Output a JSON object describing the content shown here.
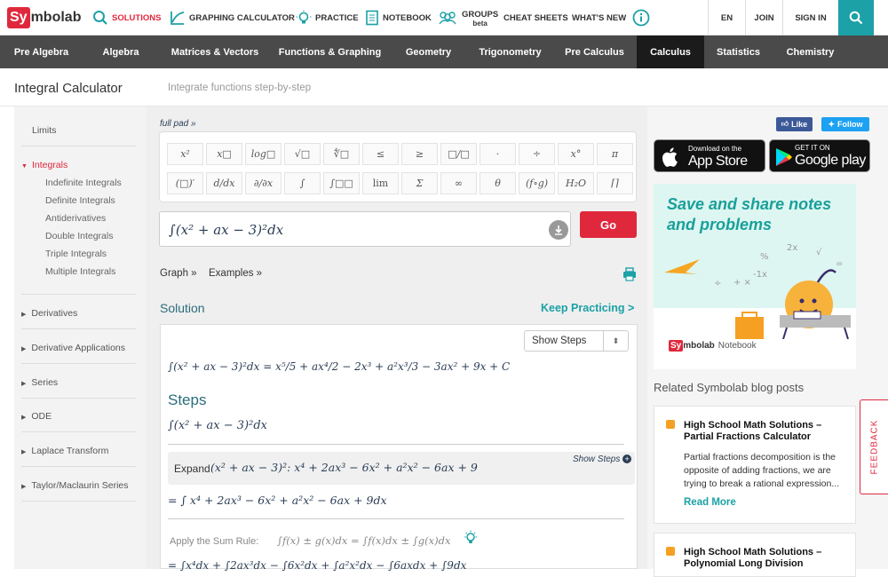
{
  "brand": {
    "sy": "Sy",
    "rest": "mbolab"
  },
  "topnav": [
    {
      "label": "SOLUTIONS",
      "icon": "search-icon"
    },
    {
      "label": "GRAPHING CALCULATOR",
      "icon": "graph-icon"
    },
    {
      "label": "PRACTICE",
      "icon": "bulb-icon"
    },
    {
      "label": "NOTEBOOK",
      "icon": "notebook-icon"
    },
    {
      "label": "GROUPS",
      "sub": "beta",
      "icon": "groups-icon"
    },
    {
      "label": "CHEAT SHEETS"
    },
    {
      "label": "WHAT'S NEW"
    }
  ],
  "topright": {
    "lang": "EN",
    "join": "JOIN",
    "signin": "SIGN IN"
  },
  "categories": [
    "Pre Algebra",
    "Algebra",
    "Matrices & Vectors",
    "Functions & Graphing",
    "Geometry",
    "Trigonometry",
    "Pre Calculus",
    "Calculus",
    "Statistics",
    "Chemistry"
  ],
  "page": {
    "title": "Integral Calculator",
    "subtitle": "Integrate functions step-by-step"
  },
  "sidebar": {
    "limits": "Limits",
    "integrals": "Integrals",
    "integral_subs": [
      "Indefinite Integrals",
      "Definite Integrals",
      "Antiderivatives",
      "Double Integrals",
      "Triple Integrals",
      "Multiple Integrals"
    ],
    "groups": [
      "Derivatives",
      "Derivative Applications",
      "Series",
      "ODE",
      "Laplace Transform",
      "Taylor/Maclaurin Series"
    ]
  },
  "keypad": {
    "full_pad": "full pad »",
    "row1": [
      "x²",
      "x□",
      "log□",
      "√□",
      "∜□",
      "≤",
      "≥",
      "□/□",
      "·",
      "÷",
      "x°",
      "π"
    ],
    "row2": [
      "(□)′",
      "d/dx",
      "∂/∂x",
      "∫",
      "∫□□",
      "lim",
      "Σ",
      "∞",
      "θ",
      "(f∘g)",
      "H₂O",
      "⌈⌉"
    ]
  },
  "input": {
    "expr": "∫(x² + ax − 3)²dx",
    "go": "Go"
  },
  "links": {
    "graph": "Graph »",
    "examples": "Examples »"
  },
  "solution": {
    "label": "Solution",
    "keep": "Keep Practicing >",
    "show_steps": "Show Steps",
    "answer_lhs": "∫(x² + ax − 3)²dx =",
    "answer_rhs": "x⁵/5 + ax⁴/2 − 2x³ + a²x³/3 − 3ax² + 9x + C",
    "steps_title": "Steps",
    "step_expr": "∫(x² + ax − 3)²dx",
    "expand_label": "Expand",
    "expand_expr": "(x² + ax − 3)²:   x⁴ + 2ax³ − 6x² + a²x² − 6ax + 9",
    "show_steps_small": "Show Steps",
    "step2": "= ∫ x⁴ + 2ax³ − 6x² + a²x² − 6ax + 9dx",
    "sum_rule_label": "Apply the Sum Rule:",
    "sum_rule_expr": "∫f(x) ± g(x)dx = ∫f(x)dx ± ∫g(x)dx",
    "step3": "= ∫x⁴dx + ∫2ax³dx − ∫6x²dx + ∫a²x²dx − ∫6axdx + ∫9dx"
  },
  "social": {
    "like": "Like",
    "follow": "Follow"
  },
  "stores": {
    "apple_top": "Download on the",
    "apple_bottom": "App Store",
    "google_top": "GET IT ON",
    "google_bottom": "Google play"
  },
  "promo": {
    "title": "Save and share notes and problems",
    "brand_sy": "Sy",
    "brand_rest": "mbolab",
    "notebook": "Notebook"
  },
  "blog": {
    "header": "Related Symbolab blog posts",
    "posts": [
      {
        "title": "High School Math Solutions – Partial Fractions Calculator",
        "excerpt": "Partial fractions decomposition is the opposite of adding fractions, we are trying to break a rational expression...",
        "read_more": "Read More"
      },
      {
        "title": "High School Math Solutions – Polynomial Long Division",
        "excerpt": "",
        "read_more": ""
      }
    ]
  },
  "feedback": "FEEDBACK",
  "colors": {
    "brand": "#e0283c",
    "teal": "#1ba1a6",
    "dark": "#4a4a4a"
  }
}
